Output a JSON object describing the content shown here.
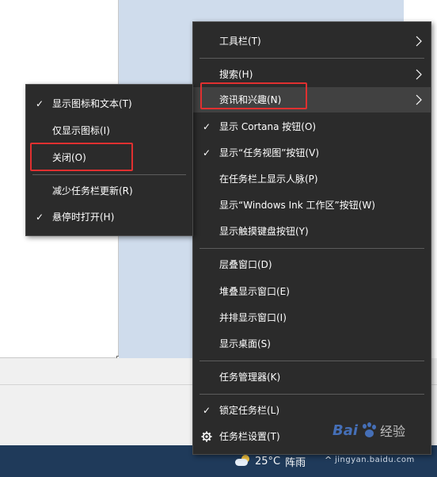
{
  "main_menu": {
    "items": [
      {
        "label": "工具栏(T)",
        "checked": false,
        "submenu": true
      },
      {
        "label": "搜索(H)",
        "checked": false,
        "submenu": true
      },
      {
        "label": "资讯和兴趣(N)",
        "checked": false,
        "submenu": true
      },
      {
        "label": "显示 Cortana 按钮(O)",
        "checked": true,
        "submenu": false
      },
      {
        "label": "显示“任务视图”按钮(V)",
        "checked": true,
        "submenu": false
      },
      {
        "label": "在任务栏上显示人脉(P)",
        "checked": false,
        "submenu": false
      },
      {
        "label": "显示“Windows Ink 工作区”按钮(W)",
        "checked": false,
        "submenu": false
      },
      {
        "label": "显示触摸键盘按钮(Y)",
        "checked": false,
        "submenu": false
      },
      {
        "label": "层叠窗口(D)",
        "checked": false,
        "submenu": false
      },
      {
        "label": "堆叠显示窗口(E)",
        "checked": false,
        "submenu": false
      },
      {
        "label": "并排显示窗口(I)",
        "checked": false,
        "submenu": false
      },
      {
        "label": "显示桌面(S)",
        "checked": false,
        "submenu": false
      },
      {
        "label": "任务管理器(K)",
        "checked": false,
        "submenu": false
      },
      {
        "label": "锁定任务栏(L)",
        "checked": true,
        "submenu": false
      },
      {
        "label": "任务栏设置(T)",
        "checked": false,
        "submenu": false,
        "icon": "gear-icon"
      }
    ]
  },
  "sub_menu": {
    "items": [
      {
        "label": "显示图标和文本(T)",
        "checked": true
      },
      {
        "label": "仅显示图标(I)",
        "checked": false
      },
      {
        "label": "关闭(O)",
        "checked": false
      },
      {
        "label": "减少任务栏更新(R)",
        "checked": false
      },
      {
        "label": "悬停时打开(H)",
        "checked": true
      }
    ]
  },
  "taskbar": {
    "temperature": "25°C",
    "weather": "阵雨",
    "weather_icon": "partly-cloudy-icon",
    "tray_chevron": "^"
  },
  "watermark": {
    "brand": "Bai",
    "brand_cn": "经验",
    "url": "jingyan.baidu.com"
  },
  "colors": {
    "menu_bg": "#2b2b2b",
    "highlight": "#414141",
    "separator": "#5c5c5c",
    "annotation": "#e03030",
    "taskbar": "#1f3a5a"
  }
}
